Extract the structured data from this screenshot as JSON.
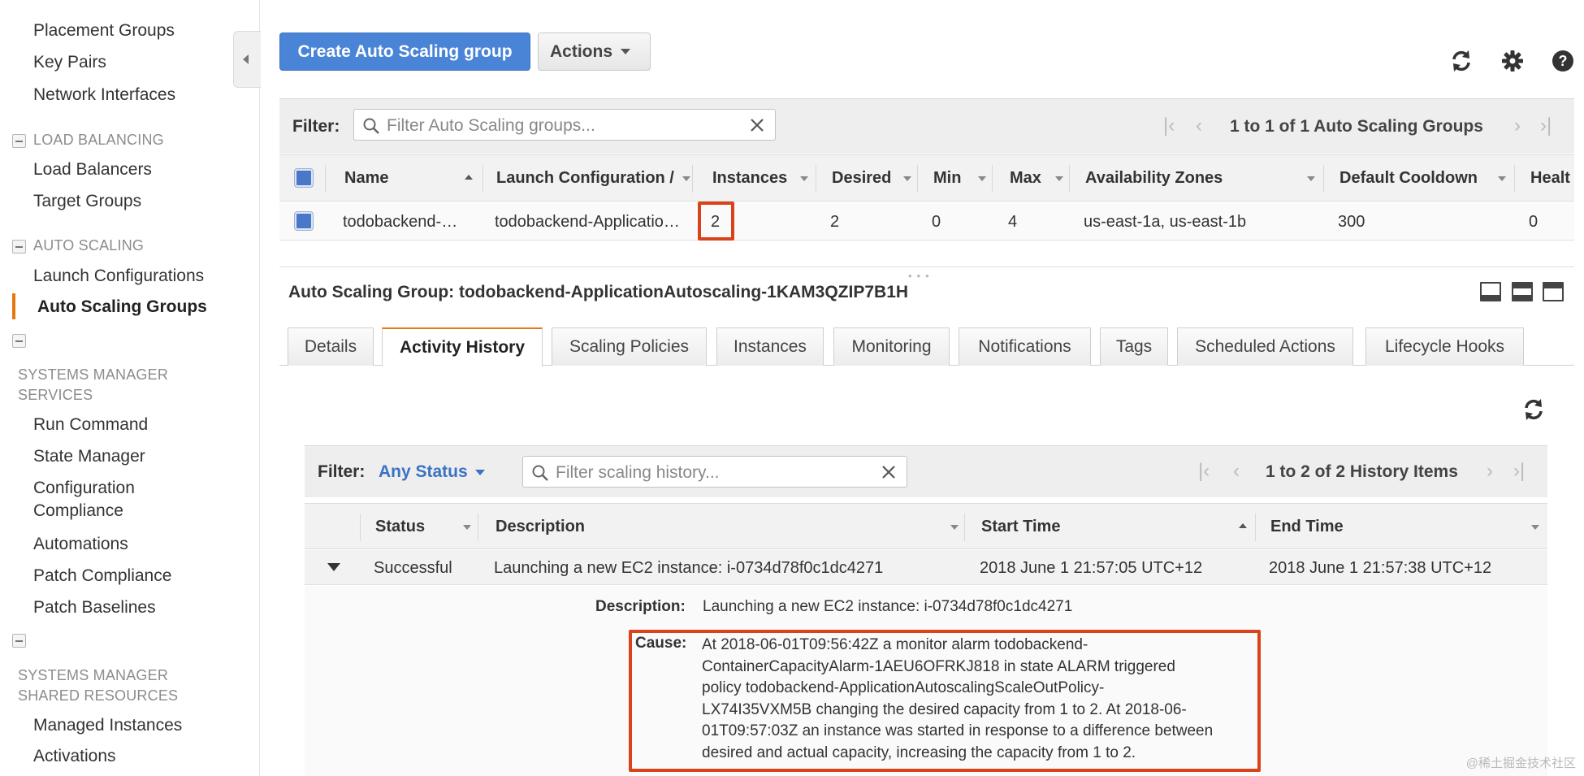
{
  "sidebar": {
    "top_items": [
      "Placement Groups",
      "Key Pairs",
      "Network Interfaces"
    ],
    "load_balancing": {
      "title": "LOAD BALANCING",
      "items": [
        "Load Balancers",
        "Target Groups"
      ]
    },
    "auto_scaling": {
      "title": "AUTO SCALING",
      "items": [
        "Launch Configurations",
        "Auto Scaling Groups"
      ],
      "active": "Auto Scaling Groups"
    },
    "systems_manager_services": {
      "title": "SYSTEMS MANAGER SERVICES",
      "items": [
        "Run Command",
        "State Manager",
        "Configuration Compliance",
        "Automations",
        "Patch Compliance",
        "Patch Baselines"
      ]
    },
    "systems_manager_shared": {
      "title": "SYSTEMS MANAGER SHARED RESOURCES",
      "items": [
        "Managed Instances",
        "Activations"
      ]
    }
  },
  "toolbar": {
    "create_label": "Create Auto Scaling group",
    "actions_label": "Actions",
    "icons": [
      "refresh-icon",
      "gear-icon",
      "help-icon"
    ]
  },
  "groups": {
    "filter_label": "Filter:",
    "search_placeholder": "Filter Auto Scaling groups...",
    "pager": "1 to 1 of 1 Auto Scaling Groups",
    "columns": [
      "Name",
      "Launch Configuration /",
      "Instances",
      "Desired",
      "Min",
      "Max",
      "Availability Zones",
      "Default Cooldown",
      "Healt"
    ],
    "row": {
      "name": "todobackend-…",
      "launch_config": "todobackend-Applicatio…",
      "instances": "2",
      "desired": "2",
      "min": "0",
      "max": "4",
      "zones": "us-east-1a, us-east-1b",
      "cooldown": "300",
      "health": "0"
    }
  },
  "detail": {
    "title": "Auto Scaling Group: todobackend-ApplicationAutoscaling-1KAM3QZIP7B1H",
    "tabs": [
      "Details",
      "Activity History",
      "Scaling Policies",
      "Instances",
      "Monitoring",
      "Notifications",
      "Tags",
      "Scheduled Actions",
      "Lifecycle Hooks"
    ],
    "active_tab": "Activity History"
  },
  "history": {
    "filter_label": "Filter:",
    "status_filter": "Any Status",
    "search_placeholder": "Filter scaling history...",
    "pager": "1 to 2 of 2 History Items",
    "columns": [
      "Status",
      "Description",
      "Start Time",
      "End Time"
    ],
    "row": {
      "status": "Successful",
      "description": "Launching a new EC2 instance: i-0734d78f0c1dc4271",
      "start_time": "2018 June 1 21:57:05 UTC+12",
      "end_time": "2018 June 1 21:57:38 UTC+12"
    },
    "expanded": {
      "description_label": "Description:",
      "description_value": "Launching a new EC2 instance: i-0734d78f0c1dc4271",
      "cause_label": "Cause:",
      "cause_lines": [
        "At 2018-06-01T09:56:42Z a monitor alarm todobackend-",
        "ContainerCapacityAlarm-1AEU6OFRKJ818 in state ALARM triggered",
        "policy todobackend-ApplicationAutoscalingScaleOutPolicy-",
        "LX74I35VXM5B changing the desired capacity from 1 to 2. At 2018-06-",
        "01T09:57:03Z an instance was started in response to a difference between",
        "desired and actual capacity, increasing the capacity from 1 to 2."
      ]
    }
  },
  "watermark": "@稀土掘金技术社区",
  "colors": {
    "primary": "#4a84d6",
    "accent": "#e47911",
    "highlight": "#d9431c",
    "link": "#3a72c4"
  }
}
